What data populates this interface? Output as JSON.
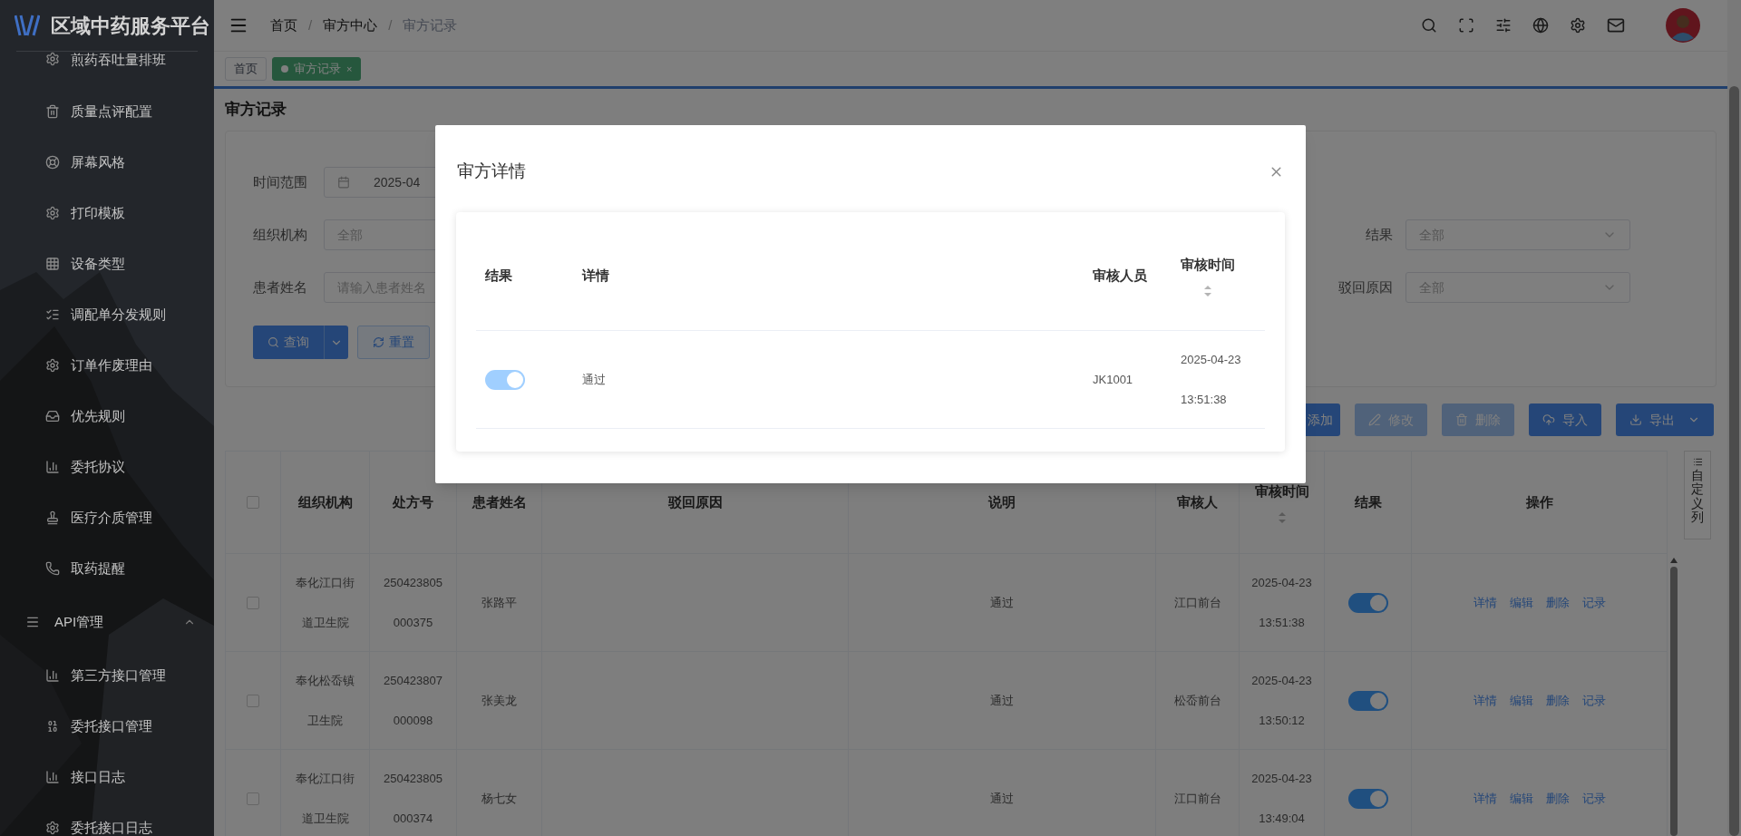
{
  "sidebar": {
    "title": "区域中药服务平台",
    "groups": [
      {
        "children": [
          {
            "label": "煎药吞吐量排班"
          },
          {
            "label": "质量点评配置"
          },
          {
            "label": "屏幕风格"
          },
          {
            "label": "打印模板"
          },
          {
            "label": "设备类型"
          },
          {
            "label": "调配单分发规则"
          },
          {
            "label": "订单作废理由"
          },
          {
            "label": "优先规则"
          },
          {
            "label": "委托协议"
          },
          {
            "label": "医疗介质管理"
          },
          {
            "label": "取药提醒"
          }
        ]
      },
      {
        "label": "API管理",
        "expanded": true,
        "children": [
          {
            "label": "第三方接口管理"
          },
          {
            "label": "委托接口管理"
          },
          {
            "label": "接口日志"
          },
          {
            "label": "委托接口日志"
          }
        ]
      }
    ]
  },
  "breadcrumbs": [
    {
      "label": "首页",
      "current": false
    },
    {
      "separator": "/",
      "label": "审方中心",
      "current": false
    },
    {
      "separator": "/",
      "label": "审方记录",
      "current": true
    }
  ],
  "tabs": [
    {
      "label": "首页",
      "selected": false
    },
    {
      "label": "审方记录",
      "selected": true,
      "close": "×"
    }
  ],
  "page_title": "审方记录",
  "filters": [
    {
      "kind": "date",
      "label": "时间范围",
      "value": "2025-04"
    },
    {
      "kind": "select",
      "label": "组织机构",
      "value": "全部"
    },
    {
      "kind": "input",
      "label": "患者姓名",
      "placeholder": "请输入患者姓名"
    }
  ],
  "right_filters": [
    {
      "label": "结果",
      "value": "全部"
    },
    {
      "label": "驳回原因",
      "value": "全部"
    }
  ],
  "search_button": "查询",
  "reset_button": "重置",
  "toolbar": [
    {
      "kind": "add",
      "label": "添加",
      "disabled": false
    },
    {
      "kind": "edit",
      "label": "修改",
      "disabled": true
    },
    {
      "kind": "delete",
      "label": "删除",
      "disabled": true
    },
    {
      "kind": "import",
      "label": "导入",
      "disabled": false
    },
    {
      "kind": "export",
      "label": "导出",
      "disabled": false
    }
  ],
  "table": {
    "select_all": false,
    "columns": [
      {
        "label": "组织机构"
      },
      {
        "label": "处方号"
      },
      {
        "label": "患者姓名"
      },
      {
        "label": "驳回原因"
      },
      {
        "label": "说明"
      },
      {
        "label": "审核人"
      },
      {
        "label": "审核时间",
        "sortable": true
      },
      {
        "label": "结果"
      },
      {
        "label": "操作"
      }
    ],
    "rows": [
      {
        "checked": false,
        "org": "奉化江口街道卫生院",
        "rx_no": "250423805000375",
        "patient": "张路平",
        "note": "通过",
        "reviewer": "江口前台",
        "time": "2025-04-23 13:51:38",
        "result_on": true,
        "actions": [
          "详情",
          "编辑",
          "删除",
          "记录"
        ]
      },
      {
        "checked": false,
        "org": "奉化松岙镇卫生院",
        "rx_no": "250423807000098",
        "patient": "张美龙",
        "note": "通过",
        "reviewer": "松岙前台",
        "time": "2025-04-23 13:50:12",
        "result_on": true,
        "actions": [
          "详情",
          "编辑",
          "删除",
          "记录"
        ]
      },
      {
        "checked": false,
        "org": "奉化江口街道卫生院",
        "rx_no": "250423805000374",
        "patient": "杨七女",
        "note": "通过",
        "reviewer": "江口前台",
        "time": "2025-04-23 13:49:04",
        "result_on": true,
        "actions": [
          "详情",
          "编辑",
          "删除",
          "记录"
        ]
      }
    ]
  },
  "custom_columns": "自定义列",
  "modal": {
    "title": "审方详情",
    "columns": [
      {
        "label": "结果"
      },
      {
        "label": "详情"
      },
      {
        "label": "审核人员"
      },
      {
        "label": "审核时间",
        "sortable": true
      }
    ],
    "rows": [
      {
        "result_on": true,
        "disabled": true,
        "detail": "通过",
        "reviewer": "JK1001",
        "time": "2025-04-23 13:51:38"
      }
    ]
  }
}
